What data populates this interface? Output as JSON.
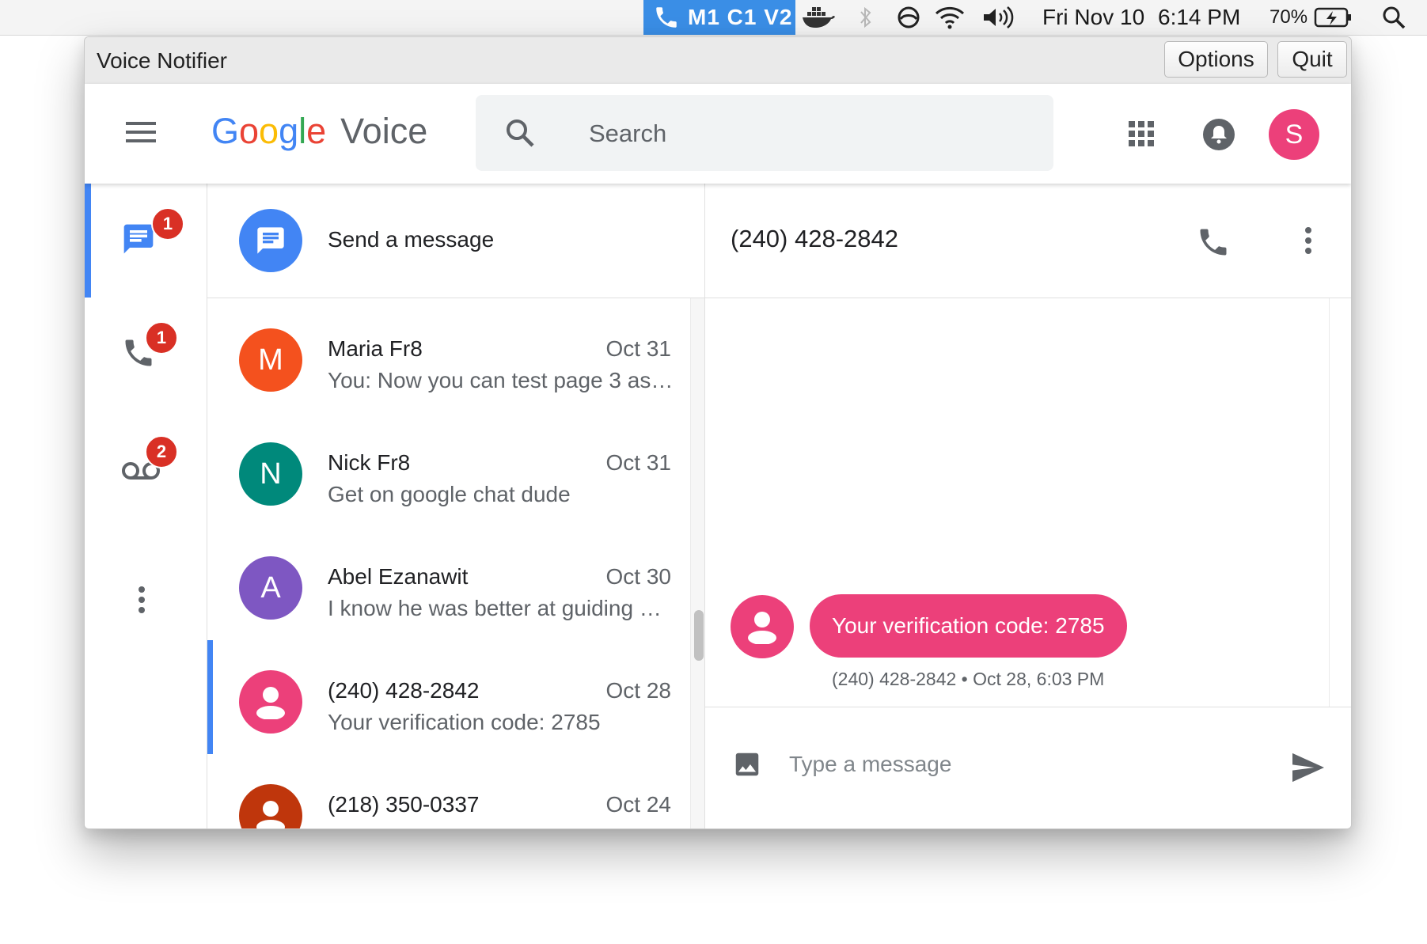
{
  "menubar": {
    "app_label": "M1 C1 V2",
    "date": "Fri Nov 10",
    "time": "6:14 PM",
    "battery_percent": "70%"
  },
  "window": {
    "title": "Voice Notifier",
    "options_label": "Options",
    "quit_label": "Quit"
  },
  "header": {
    "logo_google": [
      "G",
      "o",
      "o",
      "g",
      "l",
      "e"
    ],
    "logo_voice": "Voice",
    "search_placeholder": "Search",
    "account_initial": "S",
    "colors": {
      "google_blue": "#4285f4",
      "google_red": "#ea4335",
      "google_yellow": "#fbbc05",
      "google_green": "#34a853"
    }
  },
  "nav": {
    "items": [
      {
        "name": "messages",
        "icon": "message-icon",
        "badge": "1",
        "active": true
      },
      {
        "name": "calls",
        "icon": "phone-icon",
        "badge": "1",
        "active": false
      },
      {
        "name": "voicemail",
        "icon": "voicemail-icon",
        "badge": "2",
        "active": false
      }
    ],
    "accent": "#4285f4",
    "badge_color": "#d93025"
  },
  "conversations": {
    "send_message_label": "Send a message",
    "items": [
      {
        "avatar": "M",
        "avatar_color": "#f4511e",
        "name": "Maria Fr8",
        "date": "Oct 31",
        "snippet": "You: Now you can test page 3 as …"
      },
      {
        "avatar": "N",
        "avatar_color": "#00897b",
        "name": "Nick Fr8",
        "date": "Oct 31",
        "snippet": "Get on google chat dude"
      },
      {
        "avatar": "A",
        "avatar_color": "#7e57c2",
        "name": "Abel Ezanawit",
        "date": "Oct 30",
        "snippet": "I know he was better at guiding m…"
      },
      {
        "avatar": "person-icon",
        "avatar_color": "#ec407a",
        "name": "(240) 428-2842",
        "date": "Oct 28",
        "snippet": "Your verification code: 2785",
        "selected": true
      },
      {
        "avatar": "person-icon",
        "avatar_color": "#bf360c",
        "name": "(218) 350-0337",
        "date": "Oct 24",
        "snippet": ""
      }
    ]
  },
  "thread": {
    "title": "(240) 428-2842",
    "message_text": "Your verification code: 2785",
    "message_meta": "(240) 428-2842 • Oct 28, 6:03 PM",
    "compose_placeholder": "Type a message",
    "bubble_color": "#ec407a"
  }
}
